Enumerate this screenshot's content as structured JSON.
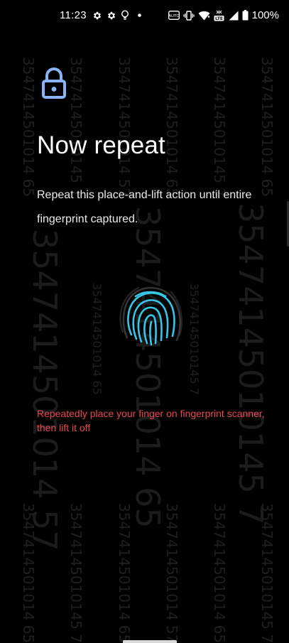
{
  "status_bar": {
    "time": "11:23",
    "battery_percent": "100%",
    "left_icons": [
      "gear-icon",
      "gear-icon",
      "bulb-icon",
      "dot-icon"
    ],
    "right_icons": [
      "auto-brightness-icon",
      "vibrate-icon",
      "wifi-icon",
      "lte-icon",
      "signal-icon",
      "battery-icon"
    ]
  },
  "page": {
    "icon": "lock-icon",
    "title": "Now repeat",
    "description": "Repeat this place-and-lift action until entire fingerprint captured.",
    "hint": "Repeatedly place your finger on fingerprint scanner, then lift it off"
  },
  "watermark": {
    "text_a": "3547414501014 65",
    "text_b": "35474145010145 7",
    "text_c": "3547414501014 57",
    "text_d": "3547414501014 65"
  },
  "colors": {
    "background": "#000000",
    "accent_blue": "#8ab4f8",
    "fingerprint_cyan": "#35c6e8",
    "hint_red": "#e8474d",
    "watermark": "#1f1f1f"
  }
}
